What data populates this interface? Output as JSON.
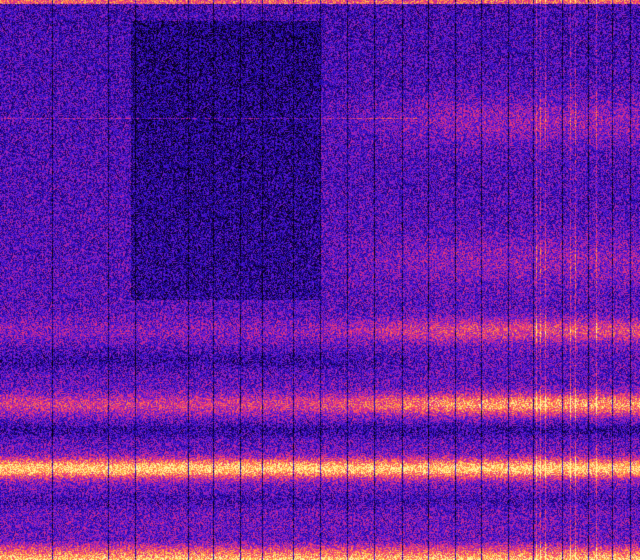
{
  "image": {
    "kind": "spectrogram",
    "colormap": [
      "#000000",
      "#1a0060",
      "#2a10c8",
      "#7a1fd0",
      "#d02890",
      "#ff5060",
      "#ffb040",
      "#fff8a0"
    ],
    "axes_visible": false,
    "text_visible": false
  }
}
